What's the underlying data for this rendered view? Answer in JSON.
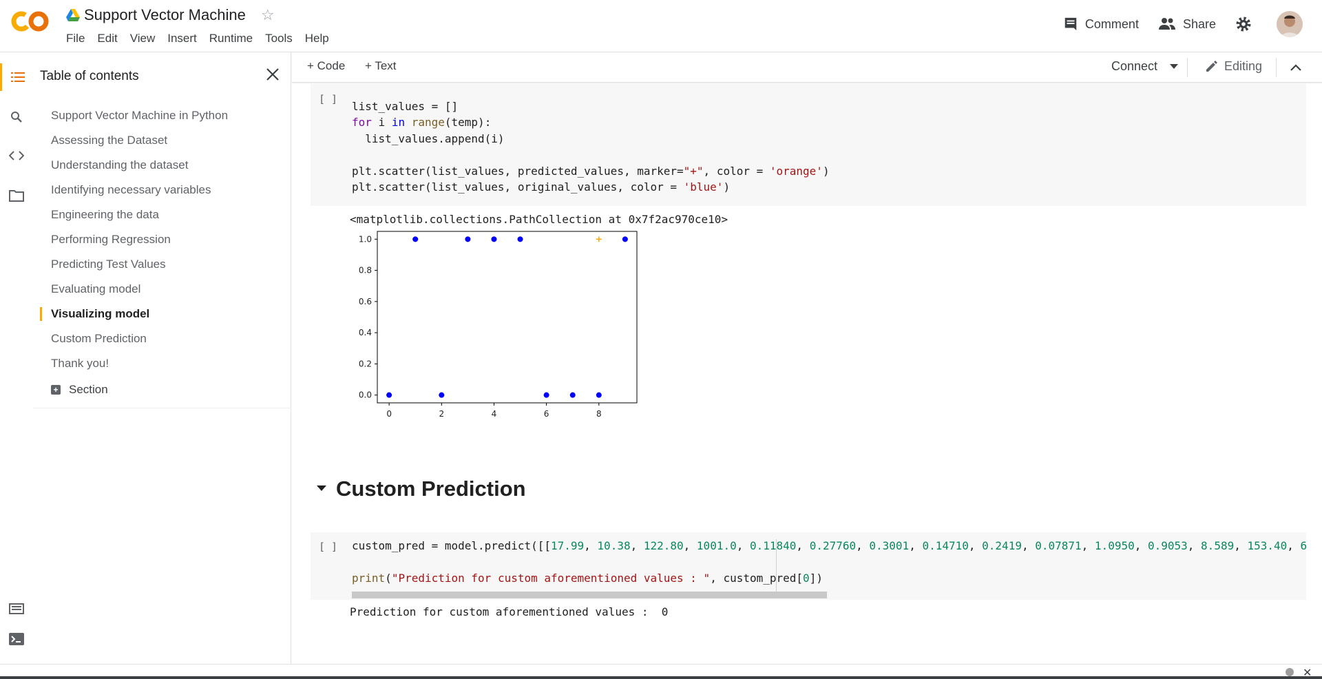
{
  "app": {
    "logo_text": "CO",
    "doc_title": "Support Vector Machine",
    "menu": [
      "File",
      "Edit",
      "View",
      "Insert",
      "Runtime",
      "Tools",
      "Help"
    ],
    "comment_label": "Comment",
    "share_label": "Share"
  },
  "toolbar": {
    "code_label": "+ Code",
    "text_label": "+ Text",
    "connect_label": "Connect",
    "editing_label": "Editing"
  },
  "toc": {
    "title": "Table of contents",
    "items": [
      "Support Vector Machine in Python",
      "Assessing the Dataset",
      "Understanding the dataset",
      "Identifying necessary variables",
      "Engineering the data",
      "Performing Regression",
      "Predicting Test Values",
      "Evaluating model",
      "Visualizing model",
      "Custom Prediction",
      "Thank you!"
    ],
    "active_index": 8,
    "section_label": "Section"
  },
  "cells": {
    "cell1_run": "[ ]",
    "cell1_output": "<matplotlib.collections.PathCollection at 0x7f2ac970ce10>",
    "heading": "Custom Prediction",
    "cell2_run": "[ ]",
    "cell2_output": "Prediction for custom aforementioned values :  0"
  },
  "chart_data": {
    "type": "scatter",
    "xlim": [
      -0.45,
      9.45
    ],
    "ylim": [
      -0.05,
      1.05
    ],
    "xticks": [
      0,
      2,
      4,
      6,
      8
    ],
    "yticks": [
      0.0,
      0.2,
      0.4,
      0.6,
      0.8,
      1.0
    ],
    "xtick_labels": [
      "0",
      "2",
      "4",
      "6",
      "8"
    ],
    "ytick_labels": [
      "0.0",
      "0.2",
      "0.4",
      "0.6",
      "0.8",
      "1.0"
    ],
    "series": [
      {
        "marker": "+",
        "color": "#ffa500",
        "x": [
          0,
          1,
          2,
          3,
          4,
          5,
          6,
          7,
          8,
          9
        ],
        "y": [
          0,
          1,
          0,
          1,
          1,
          1,
          0,
          0,
          1,
          1
        ]
      },
      {
        "marker": "o",
        "color": "#0000ff",
        "x": [
          0,
          1,
          2,
          3,
          4,
          5,
          6,
          7,
          8,
          9
        ],
        "y": [
          0,
          1,
          0,
          1,
          1,
          1,
          0,
          0,
          0,
          1
        ]
      }
    ]
  }
}
